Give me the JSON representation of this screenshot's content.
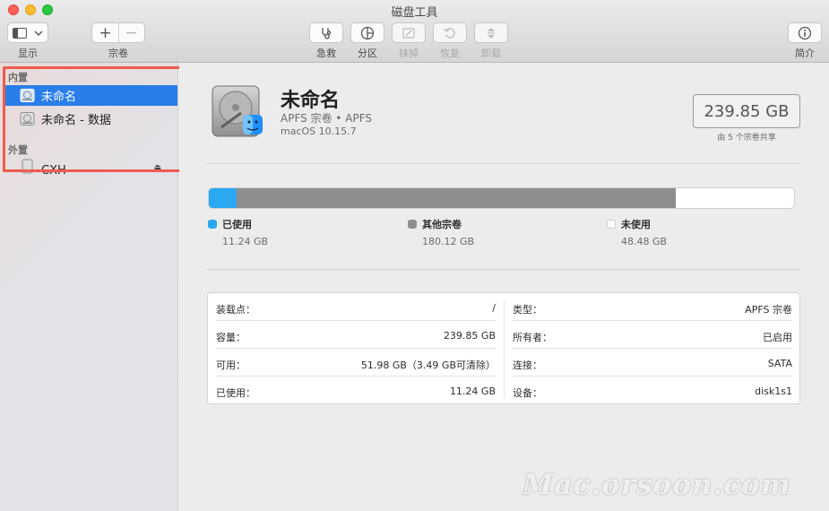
{
  "window": {
    "title": "磁盘工具"
  },
  "toolbar": {
    "view_label": "显示",
    "volume_label": "宗卷",
    "firstaid_label": "急救",
    "partition_label": "分区",
    "erase_label": "抹掉",
    "restore_label": "恢复",
    "unmount_label": "卸载",
    "info_label": "简介"
  },
  "sidebar": {
    "internal_header": "内置",
    "external_header": "外置",
    "items": [
      {
        "label": "未命名",
        "selected": true
      },
      {
        "label": "未命名 - 数据",
        "selected": false
      },
      {
        "label": "CXH",
        "selected": false
      }
    ]
  },
  "volume": {
    "name": "未命名",
    "subtitle": "APFS 宗卷 • APFS",
    "os": "macOS 10.15.7",
    "capacity": "239.85 GB",
    "shared_note": "由 5 个宗卷共享"
  },
  "usage": {
    "segments": [
      {
        "name": "已使用",
        "value": "11.24 GB",
        "gb": 11.24,
        "color": "#2aa8f2"
      },
      {
        "name": "其他宗卷",
        "value": "180.12 GB",
        "gb": 180.12,
        "color": "#8e8e8e"
      },
      {
        "name": "未使用",
        "value": "48.48 GB",
        "gb": 48.48,
        "color": "#ffffff"
      }
    ]
  },
  "info": {
    "left": [
      {
        "key": "装载点：",
        "value": "/"
      },
      {
        "key": "容量：",
        "value": "239.85 GB"
      },
      {
        "key": "可用：",
        "value": "51.98 GB（3.49 GB可清除）"
      },
      {
        "key": "已使用：",
        "value": "11.24 GB"
      }
    ],
    "right": [
      {
        "key": "类型：",
        "value": "APFS 宗卷"
      },
      {
        "key": "所有者：",
        "value": "已启用"
      },
      {
        "key": "连接：",
        "value": "SATA"
      },
      {
        "key": "设备：",
        "value": "disk1s1"
      }
    ]
  },
  "watermark": "Mac.orsoon.com",
  "colors": {
    "accent": "#2a7ee9",
    "highlight": "#ef5a4f"
  }
}
